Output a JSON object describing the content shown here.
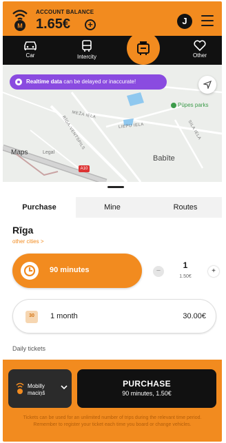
{
  "header": {
    "balance_label": "ACCOUNT BALANCE",
    "balance_amount": "1.65€",
    "avatar_initial": "J",
    "accent": "#f28b1f"
  },
  "transport_nav": {
    "items": [
      {
        "label": "Car",
        "icon": "car-icon"
      },
      {
        "label": "Intercity",
        "icon": "bus-icon"
      },
      {
        "label": "",
        "icon": "ticket-icon",
        "active": true
      },
      {
        "label": "Other",
        "icon": "heart-icon"
      }
    ]
  },
  "map": {
    "realtime_bold": "Realtime data",
    "realtime_rest": " can be delayed or inaccurate!",
    "park_label": "Pūpes parks",
    "place_label": "Babīte",
    "maps_label": "Maps",
    "legal_label": "Legal",
    "street_1": "MEŽA IELA",
    "street_2": "RĪGA-VENTSPILS",
    "street_3": "LIEPU IELA",
    "street_4": "SILA IELA",
    "road_badge": "A10"
  },
  "tabs": [
    {
      "label": "Purchase",
      "active": true
    },
    {
      "label": "Mine",
      "active": false
    },
    {
      "label": "Routes",
      "active": false
    }
  ],
  "city": {
    "name": "Rīga",
    "other_link": "other cities >"
  },
  "tickets": {
    "ticket_90": {
      "label": "90 minutes",
      "qty": "1",
      "unit_price": "1.50€"
    },
    "ticket_month": {
      "label": "1 month",
      "price": "30.00€"
    },
    "daily_heading": "Daily tickets"
  },
  "bottom": {
    "wallet_label": "Mobilly maciņš",
    "purchase_title": "PURCHASE",
    "purchase_sub": "90 minutes, 1.50€",
    "note": "Tickets can be used for an unlimited number of trips during the relevant time period. Remember to register your ticket each time you board or change vehicles."
  }
}
